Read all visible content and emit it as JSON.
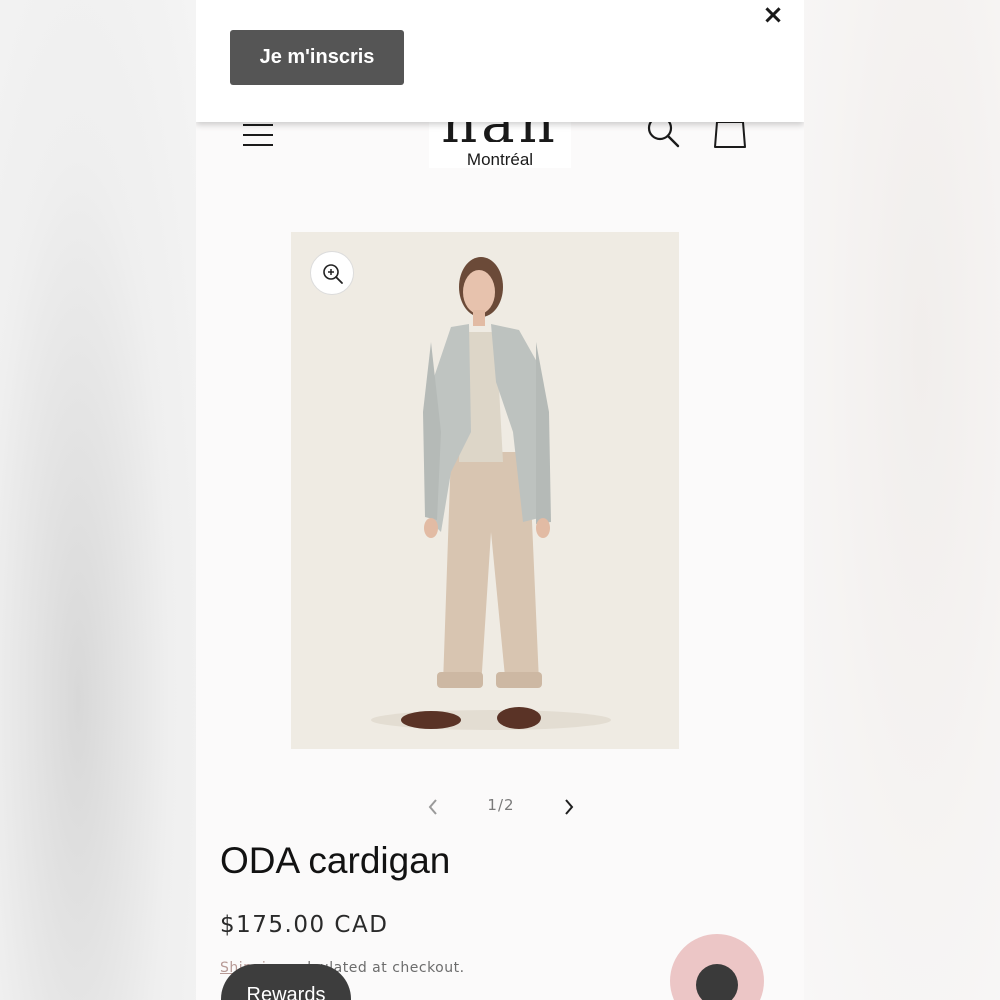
{
  "popup": {
    "close_glyph": "×",
    "signup_label": "Je m'inscris"
  },
  "header": {
    "logo_text": "nan",
    "logo_subtitle": "Montréal",
    "menu_icon": "hamburger-icon",
    "search_icon": "search-icon",
    "cart_icon": "shopping-bag-icon"
  },
  "gallery": {
    "zoom_icon": "zoom-in-icon",
    "counter": "1/2"
  },
  "product": {
    "title": "ODA cardigan",
    "price": "$175.00 CAD",
    "shipping_link": "Shipping",
    "shipping_rest": " calculated at checkout."
  },
  "floating": {
    "rewards_label": "Rewards",
    "chat_icon": "chat-icon"
  },
  "colors": {
    "popup_button": "#555555",
    "chat_bubble": "#ecc6c6",
    "rewards_bg": "#3d3d3d",
    "shipping_link": "#b79a96"
  }
}
